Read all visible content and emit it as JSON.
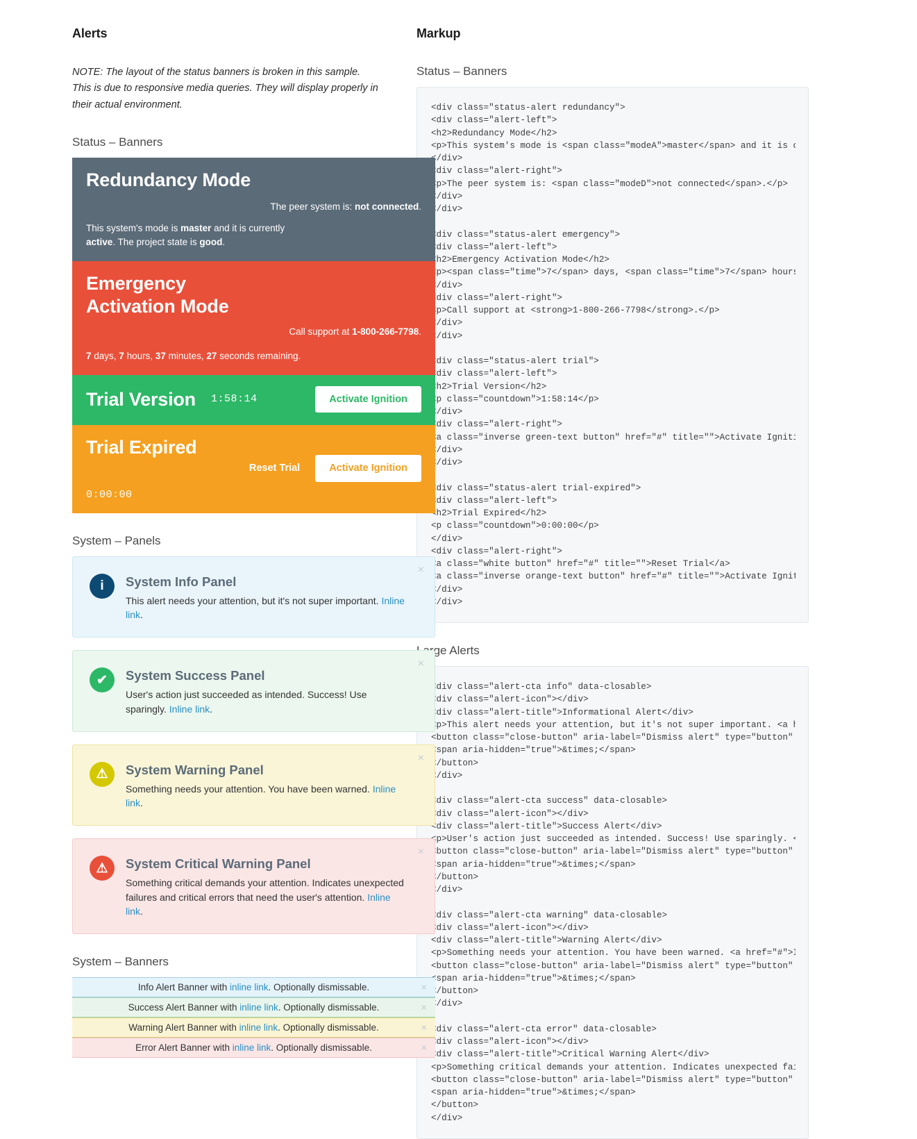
{
  "left": {
    "column_title": "Alerts",
    "note": "NOTE: The layout of the status banners is broken in this sample. This is due to responsive media queries. They will display properly in their actual environment.",
    "sections": {
      "status_banners": "Status – Banners",
      "system_panels": "System – Panels",
      "system_banners": "System – Banners"
    },
    "status_banners": [
      {
        "name": "redundancy",
        "title": "Redundancy Mode",
        "right_prefix": "The peer system is: ",
        "right_strong": "not connected",
        "right_suffix": ".",
        "desc_1": "This system's mode is ",
        "desc_mode": "master",
        "desc_2": " and it is currently ",
        "desc_state": "active",
        "desc_3": ". The project state is ",
        "desc_project": "good",
        "desc_4": ".",
        "bg": "#5b6b78"
      },
      {
        "name": "emergency",
        "title": "Emergency Activation Mode",
        "right_prefix": "Call support at ",
        "right_strong": "1-800-266-7798",
        "right_suffix": ".",
        "days": "7",
        "days_label": " days, ",
        "hours": "7",
        "hours_label": " hours, ",
        "minutes": "37",
        "minutes_label": " minutes, ",
        "seconds": "27",
        "seconds_label": " seconds remaining.",
        "bg": "#e8503a"
      },
      {
        "name": "trial",
        "title": "Trial Version",
        "countdown": "1:58:14",
        "button": "Activate Ignition",
        "bg": "#2cb866"
      },
      {
        "name": "trial-expired",
        "title": "Trial Expired",
        "countdown": "0:00:00",
        "link": "Reset Trial",
        "button": "Activate Ignition",
        "bg": "#f5a020"
      }
    ],
    "panels": [
      {
        "kind": "info",
        "icon": "info-icon",
        "glyph": "i",
        "title": "System Info Panel",
        "text": "This alert needs your attention, but it's not super important. ",
        "link": "Inline link",
        "text_after": ".",
        "close": "×"
      },
      {
        "kind": "success",
        "icon": "check-icon",
        "glyph": "✔",
        "title": "System Success Panel",
        "text": "User's action just succeeded as intended. Success! Use sparingly. ",
        "link": "Inline link",
        "text_after": ".",
        "close": "×"
      },
      {
        "kind": "warning",
        "icon": "warning-triangle-icon",
        "glyph": "⚠",
        "title": "System Warning Panel",
        "text": "Something needs your attention. You have been warned. ",
        "link": "Inline link",
        "text_after": ".",
        "close": "×"
      },
      {
        "kind": "error",
        "icon": "critical-warning-icon",
        "glyph": "⚠",
        "title": "System Critical Warning Panel",
        "text": "Something critical demands your attention. Indicates unexpected failures and critical errors that need the user's attention. ",
        "link": "Inline link",
        "text_after": ".",
        "close": "×"
      }
    ],
    "banners": [
      {
        "kind": "info",
        "before": "Info Alert Banner with ",
        "link": "inline link",
        "after": ". Optionally dismissable.",
        "close": "×"
      },
      {
        "kind": "success",
        "before": "Success Alert Banner with ",
        "link": "inline link",
        "after": ". Optionally dismissable.",
        "close": "×"
      },
      {
        "kind": "warning",
        "before": "Warning Alert Banner with ",
        "link": "inline link",
        "after": ". Optionally dismissable.",
        "close": "×"
      },
      {
        "kind": "error",
        "before": "Error Alert Banner with ",
        "link": "inline link",
        "after": ". Optionally dismissable.",
        "close": "×"
      }
    ]
  },
  "right": {
    "column_title": "Markup",
    "sections": {
      "status_banners": "Status – Banners",
      "large_alerts": "Large Alerts"
    },
    "code_status_banners": "<div class=\"status-alert redundancy\">\n<div class=\"alert-left\">\n<h2>Redundancy Mode</h2>\n<p>This system's mode is <span class=\"modeA\">master</span> and it is cur\n</div>\n<div class=\"alert-right\">\n<p>The peer system is: <span class=\"modeD\">not connected</span>.</p>\n</div>\n</div>\n\n<div class=\"status-alert emergency\">\n<div class=\"alert-left\">\n<h2>Emergency Activation Mode</h2>\n<p><span class=\"time\">7</span> days, <span class=\"time\">7</span> hours, \n</div>\n<div class=\"alert-right\">\n<p>Call support at <strong>1-800-266-7798</strong>.</p>\n</div>\n</div>\n\n<div class=\"status-alert trial\">\n<div class=\"alert-left\">\n<h2>Trial Version</h2>\n<p class=\"countdown\">1:58:14</p>\n</div>\n<div class=\"alert-right\">\n<a class=\"inverse green-text button\" href=\"#\" title=\"\">Activate Ignition\n</div>\n</div>\n\n<div class=\"status-alert trial-expired\">\n<div class=\"alert-left\">\n<h2>Trial Expired</h2>\n<p class=\"countdown\">0:00:00</p>\n</div>\n<div class=\"alert-right\">\n<a class=\"white button\" href=\"#\" title=\"\">Reset Trial</a>\n<a class=\"inverse orange-text button\" href=\"#\" title=\"\">Activate Ignitio\n</div>\n</div>",
    "code_large_alerts": "<div class=\"alert-cta info\" data-closable>\n<div class=\"alert-icon\"></div>\n<div class=\"alert-title\">Informational Alert</div>\n<p>This alert needs your attention, but it's not super important. <a hre\n<button class=\"close-button\" aria-label=\"Dismiss alert\" type=\"button\" da\n<span aria-hidden=\"true\">&times;</span>\n</button>\n</div>\n\n<div class=\"alert-cta success\" data-closable>\n<div class=\"alert-icon\"></div>\n<div class=\"alert-title\">Success Alert</div>\n<p>User's action just succeeded as intended. Success! Use sparingly. <a \n<button class=\"close-button\" aria-label=\"Dismiss alert\" type=\"button\" da\n<span aria-hidden=\"true\">&times;</span>\n</button>\n</div>\n\n<div class=\"alert-cta warning\" data-closable>\n<div class=\"alert-icon\"></div>\n<div class=\"alert-title\">Warning Alert</div>\n<p>Something needs your attention. You have been warned. <a href=\"#\">Inl\n<button class=\"close-button\" aria-label=\"Dismiss alert\" type=\"button\" da\n<span aria-hidden=\"true\">&times;</span>\n</button>\n</div>\n\n<div class=\"alert-cta error\" data-closable>\n<div class=\"alert-icon\"></div>\n<div class=\"alert-title\">Critical Warning Alert</div>\n<p>Something critical demands your attention. Indicates unexpected failu\n<button class=\"close-button\" aria-label=\"Dismiss alert\" type=\"button\" da\n<span aria-hidden=\"true\">&times;</span>\n</button>\n</div>"
  }
}
